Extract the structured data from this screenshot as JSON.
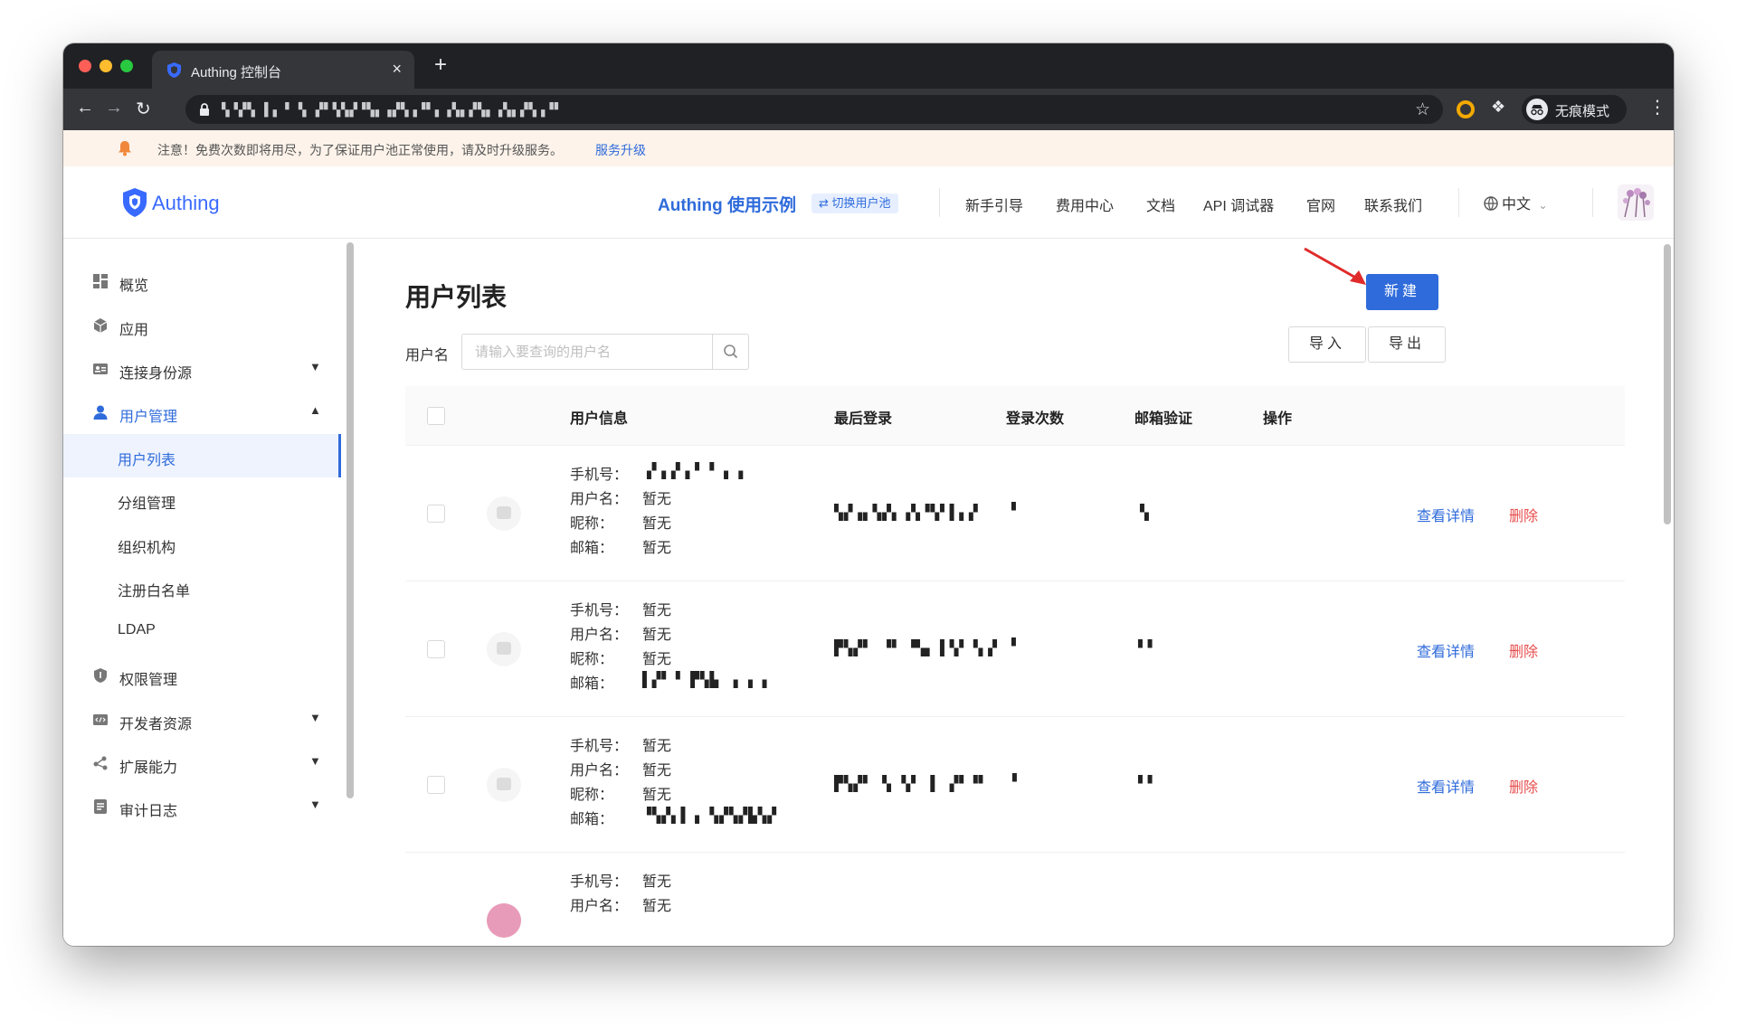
{
  "browser": {
    "tab_title": "Authing 控制台",
    "tab_close": "×",
    "new_tab": "+",
    "url": "▚▝▞▚ ▌▖▝ ▚ ▞▘▚▚▞▝▚▖▗▞▚▗▝▘▖▗▚▖▞▚▖▗▚▖▞▚▗▝▘",
    "incognito_label": "无痕模式",
    "accent_colors": {
      "ring": "#f2a900"
    }
  },
  "notice": {
    "text": "注意！免费次数即将用尽，为了保证用户池正常使用，请及时升级服务。",
    "link": "服务升级"
  },
  "header": {
    "logo_text": "Authing",
    "pool_name": "Authing 使用示例",
    "switch_pool": "⇄ 切换用户池",
    "links": [
      "新手引导",
      "费用中心",
      "文档",
      "API 调试器",
      "官网",
      "联系我们"
    ],
    "language": "中文"
  },
  "sidebar": {
    "items": [
      {
        "label": "概览",
        "icon": "dashboard-icon"
      },
      {
        "label": "应用",
        "icon": "cube-icon"
      },
      {
        "label": "连接身份源",
        "icon": "id-card-icon",
        "expandable": true
      },
      {
        "label": "用户管理",
        "icon": "user-icon",
        "expanded": true
      },
      {
        "label": "权限管理",
        "icon": "shield-icon"
      },
      {
        "label": "开发者资源",
        "icon": "code-icon",
        "expandable": true
      },
      {
        "label": "扩展能力",
        "icon": "share-icon",
        "expandable": true
      },
      {
        "label": "审计日志",
        "icon": "log-icon",
        "expandable": true
      }
    ],
    "user_management_children": [
      "用户列表",
      "分组管理",
      "组织机构",
      "注册白名单",
      "LDAP"
    ],
    "selected": "用户列表"
  },
  "main": {
    "title": "用户列表",
    "new_button": "新建",
    "filter_label": "用户名",
    "search_placeholder": "请输入要查询的用户名",
    "import_button": "导入",
    "export_button": "导出",
    "columns": [
      "用户信息",
      "最后登录",
      "登录次数",
      "邮箱验证",
      "操作"
    ],
    "info_keys": {
      "phone": "手机号：",
      "username": "用户名：",
      "nickname": "昵称：",
      "email": "邮箱："
    },
    "actions": {
      "view": "查看详情",
      "delete": "删除"
    },
    "rows": [
      {
        "phone": "▗▘▖▞▗▝ ▘▗ ▖",
        "username": "暂无",
        "nickname": "暂无",
        "email": "暂无",
        "last_login": "▚▞▗▖▚▞▖▗▚▝▚▘▌▖▞",
        "login_count": "▘",
        "email_verified": "▚"
      },
      {
        "phone": "暂无",
        "username": "暂无",
        "nickname": "暂无",
        "email": "▌▞▘▝ ▛▚▙ ▗ ▖▗",
        "last_login": "▛▚▞▘ ▝▘ ▀▄ ▌▚▘▝▖▞",
        "login_count": "▘",
        "email_verified": "▘▘"
      },
      {
        "phone": "暂无",
        "username": "暂无",
        "nickname": "暂无",
        "email": "▝▚▞▖▌▗ ▚▞▚▞▙▚▞",
        "last_login": "▛▚▞▘ ▚ ▚▘ ▌ ▞▘▝▘",
        "login_count": "▝",
        "email_verified": "▘▘"
      },
      {
        "phone": "暂无",
        "username": "暂无",
        "nickname": "",
        "email": "",
        "last_login": "",
        "login_count": "",
        "email_verified": ""
      }
    ]
  }
}
